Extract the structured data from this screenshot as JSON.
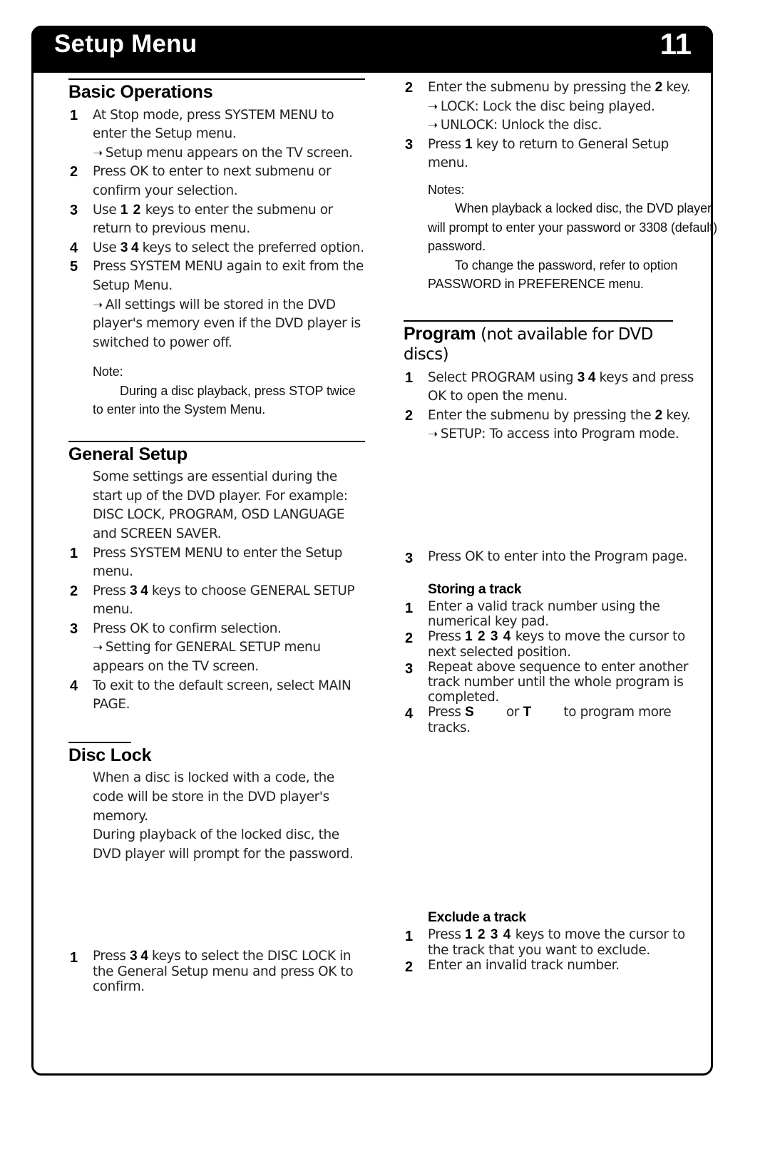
{
  "header": {
    "title": "Setup Menu",
    "page_number": "11"
  },
  "left_column": {
    "basic_operations": {
      "heading": "Basic Operations",
      "steps": [
        {
          "num": "1",
          "text": "At Stop mode, press SYSTEM MENU to enter the Setup menu.",
          "arrows": [
            "Setup menu appears on the TV screen."
          ]
        },
        {
          "num": "2",
          "text": "Press OK to enter to next submenu or confirm your selection.",
          "arrows": []
        },
        {
          "num": "3",
          "text_pre": "Use ",
          "keys": "1 2",
          "text_post": " keys to enter the submenu or return to previous menu.",
          "arrows": []
        },
        {
          "num": "4",
          "text_pre": "Use ",
          "keys": "3 4",
          "text_post": " keys to select the preferred option.",
          "arrows": []
        },
        {
          "num": "5",
          "text": "Press SYSTEM MENU again to exit from the Setup Menu.",
          "arrows": [
            "All settings will be stored in the DVD player's memory even if the DVD player is switched to power off."
          ]
        }
      ],
      "note_title": "Note:",
      "note_body": "During a disc playback, press STOP twice to enter into the System Menu."
    },
    "general_setup": {
      "heading": "General Setup",
      "intro": "Some settings are essential during the start up of the DVD player. For example: DISC LOCK, PROGRAM, OSD LANGUAGE and SCREEN SAVER.",
      "steps": [
        {
          "num": "1",
          "text": "Press SYSTEM MENU to enter the Setup menu.",
          "arrows": []
        },
        {
          "num": "2",
          "text_pre": "Press ",
          "keys": "3 4",
          "text_post": " keys to choose GENERAL SETUP menu.",
          "arrows": []
        },
        {
          "num": "3",
          "text": "Press OK to confirm selection.",
          "arrows": [
            "Setting for GENERAL SETUP menu appears on the TV screen."
          ]
        },
        {
          "num": "4",
          "text": "To exit to the default screen, select MAIN PAGE.",
          "arrows": []
        }
      ]
    },
    "disc_lock": {
      "heading": "Disc Lock",
      "paragraphs": [
        "When a disc is locked with a code, the code will be store in the DVD player's memory.",
        "During playback of the locked disc, the DVD player will prompt for the password."
      ],
      "bottom_step": {
        "num": "1",
        "text_pre": "Press ",
        "keys": "3 4",
        "text_post": " keys to select the DISC LOCK in the General Setup menu and press OK to confirm."
      }
    }
  },
  "right_column": {
    "disc_lock_cont": {
      "steps": [
        {
          "num": "2",
          "text_pre": "Enter the submenu by pressing the ",
          "keys": "2",
          "text_post": " key.",
          "arrows": [
            "LOCK: Lock the disc being played.",
            "UNLOCK: Unlock the disc."
          ]
        },
        {
          "num": "3",
          "text_pre": "Press ",
          "keys": "1",
          "text_post": " key to return to General Setup menu.",
          "arrows": []
        }
      ],
      "notes_title": "Notes:",
      "notes_body_1": "When playback a locked disc, the DVD player will prompt to enter your password or 3308 (default) password.",
      "notes_body_2": "To change the password, refer to option PASSWORD in PREFERENCE menu."
    },
    "program": {
      "heading": "Program",
      "heading_sub": "(not available for DVD discs)",
      "steps": [
        {
          "num": "1",
          "text_pre": "Select PROGRAM using ",
          "keys": "3 4",
          "text_post": " keys and press OK to open the menu.",
          "arrows": []
        },
        {
          "num": "2",
          "text_pre": "Enter the submenu by pressing the ",
          "keys": "2",
          "text_post": " key.",
          "arrows": [
            "SETUP: To access into Program mode."
          ]
        },
        {
          "num": "3",
          "text": "Press OK to enter into the Program page.",
          "arrows": []
        }
      ]
    },
    "storing_a_track": {
      "heading": "Storing a track",
      "steps": [
        {
          "num": "1",
          "text": "Enter a valid track number using the numerical key pad.",
          "arrows": []
        },
        {
          "num": "2",
          "text_pre": "Press ",
          "keys": "1 2 3 4",
          "text_post": " keys to move the cursor to next selected position.",
          "arrows": []
        },
        {
          "num": "3",
          "text": "Repeat above sequence to enter another track number until the whole program is completed.",
          "arrows": []
        },
        {
          "num": "4",
          "text_pre": "Press ",
          "keys": "S",
          "text_mid": " or ",
          "keys2": "T",
          "text_post": " to program more tracks.",
          "arrows": []
        }
      ]
    },
    "exclude_a_track": {
      "heading": "Exclude a track",
      "steps": [
        {
          "num": "1",
          "text_pre": "Press ",
          "keys": "1 2 3 4",
          "text_post": " keys to move the cursor to the track that you want to exclude.",
          "arrows": []
        },
        {
          "num": "2",
          "text": "Enter an invalid track number.",
          "arrows": []
        }
      ]
    }
  },
  "icons": {
    "arrow_bullet": "arrow-right-bullet"
  },
  "colors": {
    "banner_bg": "#000000",
    "banner_text": "#ffffff",
    "body_text": "#222222",
    "page_border": "#000000"
  }
}
